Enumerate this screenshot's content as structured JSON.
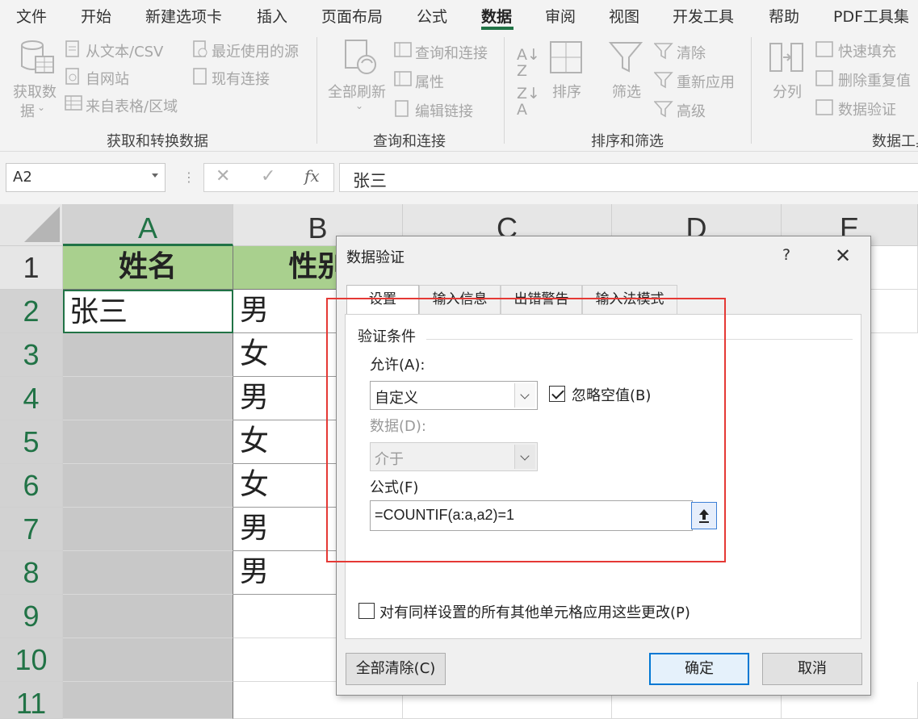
{
  "menu": {
    "tabs": [
      {
        "label": "文件"
      },
      {
        "label": "开始"
      },
      {
        "label": "新建选项卡"
      },
      {
        "label": "插入"
      },
      {
        "label": "页面布局"
      },
      {
        "label": "公式"
      },
      {
        "label": "数据"
      },
      {
        "label": "审阅"
      },
      {
        "label": "视图"
      },
      {
        "label": "开发工具"
      },
      {
        "label": "帮助"
      },
      {
        "label": "PDF工具集"
      }
    ],
    "active_tab": "数据"
  },
  "ribbon": {
    "get_data": {
      "big_button_line1": "获取数",
      "big_button_line2": "据",
      "from_text": "从文本/CSV",
      "from_web": "自网站",
      "from_table": "来自表格/区域",
      "recent_sources": "最近使用的源",
      "existing_connections": "现有连接",
      "group_label": "获取和转换数据"
    },
    "queries": {
      "refresh_all": "全部刷新",
      "queries_connections": "查询和连接",
      "properties": "属性",
      "edit_links": "编辑链接",
      "group_label": "查询和连接"
    },
    "sort_filter": {
      "sort": "排序",
      "filter": "筛选",
      "clear": "清除",
      "reapply": "重新应用",
      "advanced": "高级",
      "group_label": "排序和筛选"
    },
    "data_tools": {
      "text_to_columns": "分列",
      "flash_fill": "快速填充",
      "remove_duplicates": "删除重复值",
      "data_validation": "数据验证",
      "group_label": "数据工具"
    }
  },
  "formula_bar": {
    "name_box": "A2",
    "cancel_symbol": "✕",
    "enter_symbol": "✓",
    "fx_symbol": "fx",
    "content": "张三"
  },
  "sheet": {
    "columns": [
      "A",
      "B",
      "C",
      "D",
      "E"
    ],
    "rows": [
      "1",
      "2",
      "3",
      "4",
      "5",
      "6",
      "7",
      "8",
      "9",
      "10",
      "11"
    ],
    "header_a": "姓名",
    "header_b": "性别",
    "a2": "张三",
    "b_values": [
      "男",
      "女",
      "男",
      "女",
      "女",
      "男",
      "男"
    ]
  },
  "dialog": {
    "title": "数据验证",
    "help": "?",
    "close": "✕",
    "tabs": [
      "设置",
      "输入信息",
      "出错警告",
      "输入法模式"
    ],
    "group_title": "验证条件",
    "allow_label": "允许(A):",
    "allow_value": "自定义",
    "ignore_blank_label": "忽略空值(B)",
    "ignore_blank_checked": true,
    "data_label": "数据(D):",
    "data_value": "介于",
    "formula_label": "公式(F)",
    "formula_value": "=COUNTIF(a:a,a2)=1",
    "apply_all_label": "对有同样设置的所有其他单元格应用这些更改(P)",
    "apply_all_checked": false,
    "clear_all": "全部清除(C)",
    "ok": "确定",
    "cancel": "取消"
  },
  "colors": {
    "header_fill": "#a9d08e",
    "selection_green": "#217346",
    "grey_fill": "#c8c8c8",
    "annotation_red": "#e53935"
  }
}
